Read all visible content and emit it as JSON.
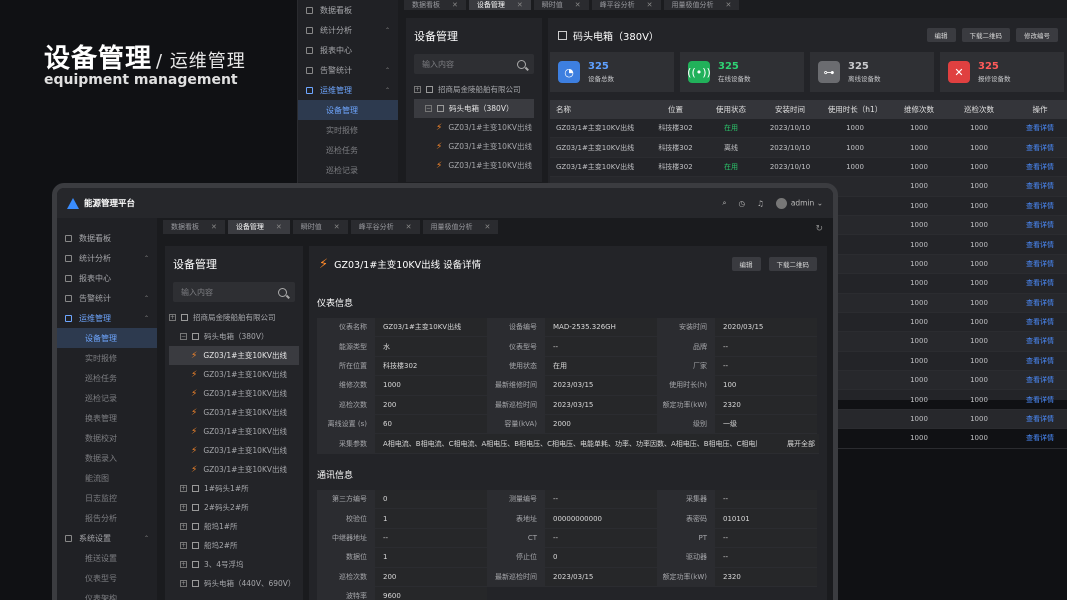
{
  "hero": {
    "title": "设备管理",
    "sub_title": "运维管理",
    "english": "equipment management"
  },
  "back": {
    "nav": [
      {
        "label": "数据看板",
        "type": "item"
      },
      {
        "label": "统计分析",
        "type": "item",
        "arrow": "^"
      },
      {
        "label": "报表中心",
        "type": "item"
      },
      {
        "label": "告警统计",
        "type": "item",
        "arrow": "^"
      },
      {
        "label": "运维管理",
        "type": "item",
        "arrow": "^",
        "active": true
      },
      {
        "label": "设备管理",
        "type": "sub",
        "selected": true
      },
      {
        "label": "实时报修",
        "type": "sub"
      },
      {
        "label": "巡检任务",
        "type": "sub"
      },
      {
        "label": "巡检记录",
        "type": "sub"
      }
    ],
    "tabs": [
      {
        "label": "数据看板"
      },
      {
        "label": "设备管理",
        "active": true
      },
      {
        "label": "瞬时值"
      },
      {
        "label": "峰平谷分析"
      },
      {
        "label": "用量极值分析"
      }
    ],
    "tree_title": "设备管理",
    "search_placeholder": "输入内容",
    "tree": [
      {
        "label": "招商局金陵船舶有限公司",
        "kind": "root",
        "level": 0
      },
      {
        "label": "码头电箱（380V）",
        "kind": "group",
        "level": 1,
        "selected": true
      },
      {
        "label": "GZ03/1#主变10KV出线",
        "kind": "leaf",
        "level": 2
      },
      {
        "label": "GZ03/1#主变10KV出线",
        "kind": "leaf",
        "level": 2
      },
      {
        "label": "GZ03/1#主变10KV出线",
        "kind": "leaf",
        "level": 2
      }
    ],
    "main_title": "码头电箱（380V）",
    "buttons": [
      "编辑",
      "下载二维码",
      "修改编号"
    ],
    "stats": [
      {
        "num": "325",
        "label": "设备总数",
        "color": "#3d7fe0",
        "num_color": "#5ea0ff",
        "icon": "gauge-icon",
        "glyph": "◔"
      },
      {
        "num": "325",
        "label": "在线设备数",
        "color": "#21b15a",
        "num_color": "#2fd173",
        "icon": "signal-icon",
        "glyph": "((•))"
      },
      {
        "num": "325",
        "label": "离线设备数",
        "color": "#6b6c70",
        "num_color": "#c8c9cc",
        "icon": "link-off-icon",
        "glyph": "⊶"
      },
      {
        "num": "325",
        "label": "报修设备数",
        "color": "#e04040",
        "num_color": "#ff5a5a",
        "icon": "tools-icon",
        "glyph": "✕"
      }
    ],
    "columns": [
      "名称",
      "位置",
      "使用状态",
      "安装时间",
      "使用时长（h1）",
      "维修次数",
      "巡检次数",
      "操作"
    ],
    "rows": [
      [
        "GZ03/1#主变10KV出线",
        "科技楼302",
        "在用",
        "2023/10/10",
        "1000",
        "1000",
        "1000",
        "查看详情"
      ],
      [
        "GZ03/1#主变10KV出线",
        "科技楼302",
        "离线",
        "2023/10/10",
        "1000",
        "1000",
        "1000",
        "查看详情"
      ],
      [
        "GZ03/1#主变10KV出线",
        "科技楼302",
        "在用",
        "2023/10/10",
        "1000",
        "1000",
        "1000",
        "查看详情"
      ]
    ],
    "extra_rows": [
      [
        "1000",
        "1000",
        "查看详情"
      ],
      [
        "1000",
        "1000",
        "查看详情"
      ],
      [
        "1000",
        "1000",
        "查看详情"
      ],
      [
        "1000",
        "1000",
        "查看详情"
      ],
      [
        "1000",
        "1000",
        "查看详情"
      ],
      [
        "1000",
        "1000",
        "查看详情"
      ],
      [
        "1000",
        "1000",
        "查看详情"
      ],
      [
        "1000",
        "1000",
        "查看详情"
      ],
      [
        "1000",
        "1000",
        "查看详情"
      ],
      [
        "1000",
        "1000",
        "查看详情"
      ],
      [
        "1000",
        "1000",
        "查看详情"
      ],
      [
        "1000",
        "1000",
        "查看详情"
      ],
      [
        "1000",
        "1000",
        "查看详情"
      ],
      [
        "1000",
        "1000",
        "查看详情"
      ]
    ]
  },
  "front": {
    "brand": "能源管理平台",
    "user": "admin",
    "nav": [
      {
        "label": "数据看板",
        "type": "item"
      },
      {
        "label": "统计分析",
        "type": "item",
        "arrow": "^"
      },
      {
        "label": "报表中心",
        "type": "item"
      },
      {
        "label": "告警统计",
        "type": "item",
        "arrow": "^"
      },
      {
        "label": "运维管理",
        "type": "item",
        "arrow": "^",
        "active": true
      },
      {
        "label": "设备管理",
        "type": "sub",
        "selected": true
      },
      {
        "label": "实时报修",
        "type": "sub"
      },
      {
        "label": "巡检任务",
        "type": "sub"
      },
      {
        "label": "巡检记录",
        "type": "sub"
      },
      {
        "label": "换表管理",
        "type": "sub"
      },
      {
        "label": "数据校对",
        "type": "sub"
      },
      {
        "label": "数据录入",
        "type": "sub"
      },
      {
        "label": "能流图",
        "type": "sub"
      },
      {
        "label": "日志监控",
        "type": "sub"
      },
      {
        "label": "报告分析",
        "type": "sub"
      },
      {
        "label": "系统设置",
        "type": "item",
        "arrow": "^"
      },
      {
        "label": "推送设置",
        "type": "sub"
      },
      {
        "label": "仪表型号",
        "type": "sub"
      },
      {
        "label": "仪表架构",
        "type": "sub"
      }
    ],
    "tabs": [
      {
        "label": "数据看板"
      },
      {
        "label": "设备管理",
        "active": true
      },
      {
        "label": "瞬时值"
      },
      {
        "label": "峰平谷分析"
      },
      {
        "label": "用量极值分析"
      }
    ],
    "tree_title": "设备管理",
    "search_placeholder": "输入内容",
    "tree": [
      {
        "label": "招商局金陵船舶有限公司",
        "kind": "root",
        "level": 0,
        "pm": "+"
      },
      {
        "label": "码头电箱（380V）",
        "kind": "group",
        "level": 1,
        "pm": "−"
      },
      {
        "label": "GZ03/1#主变10KV出线",
        "kind": "leaf",
        "level": 2,
        "selected": true
      },
      {
        "label": "GZ03/1#主变10KV出线",
        "kind": "leaf",
        "level": 2
      },
      {
        "label": "GZ03/1#主变10KV出线",
        "kind": "leaf",
        "level": 2
      },
      {
        "label": "GZ03/1#主变10KV出线",
        "kind": "leaf",
        "level": 2
      },
      {
        "label": "GZ03/1#主变10KV出线",
        "kind": "leaf",
        "level": 2
      },
      {
        "label": "GZ03/1#主变10KV出线",
        "kind": "leaf",
        "level": 2
      },
      {
        "label": "GZ03/1#主变10KV出线",
        "kind": "leaf",
        "level": 2
      },
      {
        "label": "1#码头1#所",
        "kind": "group",
        "level": 1,
        "pm": "+"
      },
      {
        "label": "2#码头2#所",
        "kind": "group",
        "level": 1,
        "pm": "+"
      },
      {
        "label": "船坞1#所",
        "kind": "group",
        "level": 1,
        "pm": "+"
      },
      {
        "label": "船坞2#所",
        "kind": "group",
        "level": 1,
        "pm": "+"
      },
      {
        "label": "3、4号浮坞",
        "kind": "group",
        "level": 1,
        "pm": "+"
      },
      {
        "label": "码头电箱（440V、690V）",
        "kind": "group",
        "level": 1,
        "pm": "+"
      }
    ],
    "detail_title": "GZ03/1#主变10KV出线 设备详情",
    "buttons": [
      "编辑",
      "下载二维码"
    ],
    "sec_meter": "仪表信息",
    "meter": [
      [
        [
          "仪表名称",
          "GZ03/1#主变10KV出线"
        ],
        [
          "设备编号",
          "MAD-2535.326GH"
        ],
        [
          "安装时间",
          "2020/03/15"
        ]
      ],
      [
        [
          "能源类型",
          "水"
        ],
        [
          "仪表型号",
          "--"
        ],
        [
          "品牌",
          "--"
        ]
      ],
      [
        [
          "所在位置",
          "科技楼302"
        ],
        [
          "使用状态",
          "在用"
        ],
        [
          "厂家",
          "--"
        ]
      ],
      [
        [
          "维修次数",
          "1000"
        ],
        [
          "最新维修时间",
          "2023/03/15"
        ],
        [
          "使用时长(h)",
          "100"
        ]
      ],
      [
        [
          "巡检次数",
          "200"
        ],
        [
          "最新巡检时间",
          "2023/03/15"
        ],
        [
          "额定功率(kW)",
          "2320"
        ]
      ],
      [
        [
          "离线设置 (s)",
          "60"
        ],
        [
          "容量(kVA)",
          "2000"
        ],
        [
          "级别",
          "一级"
        ]
      ]
    ],
    "collect_label": "采集参数",
    "collect_value": "A相电流、B相电流、C相电流、A相电压、B相电压、C相电压、电能单耗、功率、功率因数、A相电压、B相电压、C相电压…",
    "expand": "展开全部",
    "sec_comm": "通讯信息",
    "comm": [
      [
        [
          "第三方编号",
          "0"
        ],
        [
          "测量编号",
          "--"
        ],
        [
          "采集器",
          "--"
        ]
      ],
      [
        [
          "校验位",
          "1"
        ],
        [
          "表地址",
          "00000000000"
        ],
        [
          "表密码",
          "010101"
        ]
      ],
      [
        [
          "中继器地址",
          "--"
        ],
        [
          "CT",
          "--"
        ],
        [
          "PT",
          "--"
        ]
      ],
      [
        [
          "数据位",
          "1"
        ],
        [
          "停止位",
          "0"
        ],
        [
          "驱动器",
          "--"
        ]
      ],
      [
        [
          "巡检次数",
          "200"
        ],
        [
          "最新巡检时间",
          "2023/03/15"
        ],
        [
          "额定功率(kW)",
          "2320"
        ]
      ]
    ],
    "baud_label": "波特率",
    "baud_value": "9600"
  }
}
